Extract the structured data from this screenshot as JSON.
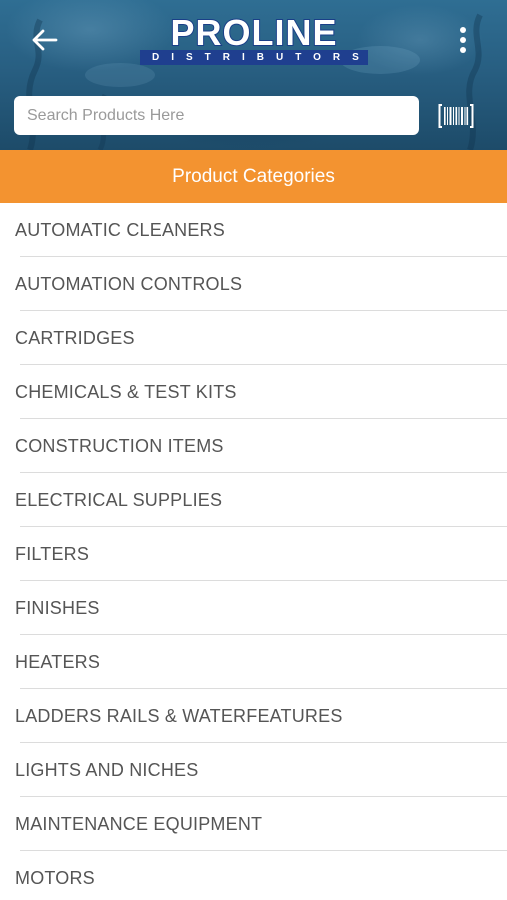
{
  "header": {
    "logo": {
      "brand": "PROLINE",
      "subtitle": "DISTRIBUTORS"
    },
    "back_icon": "back-arrow-icon",
    "menu_icon": "more-vertical-icon",
    "barcode_icon": "barcode-icon",
    "colors": {
      "header_bg": "#2a6388",
      "logo_blue": "#1f3f8f"
    }
  },
  "search": {
    "placeholder": "Search Products Here",
    "value": ""
  },
  "categories_bar": {
    "title": "Product Categories",
    "color": "#f39330"
  },
  "categories": [
    "AUTOMATIC CLEANERS",
    "AUTOMATION CONTROLS",
    "CARTRIDGES",
    "CHEMICALS & TEST KITS",
    "CONSTRUCTION ITEMS",
    "ELECTRICAL SUPPLIES",
    "FILTERS",
    "FINISHES",
    "HEATERS",
    "LADDERS RAILS & WATERFEATURES",
    "LIGHTS AND NICHES",
    "MAINTENANCE EQUIPMENT",
    "MOTORS"
  ]
}
